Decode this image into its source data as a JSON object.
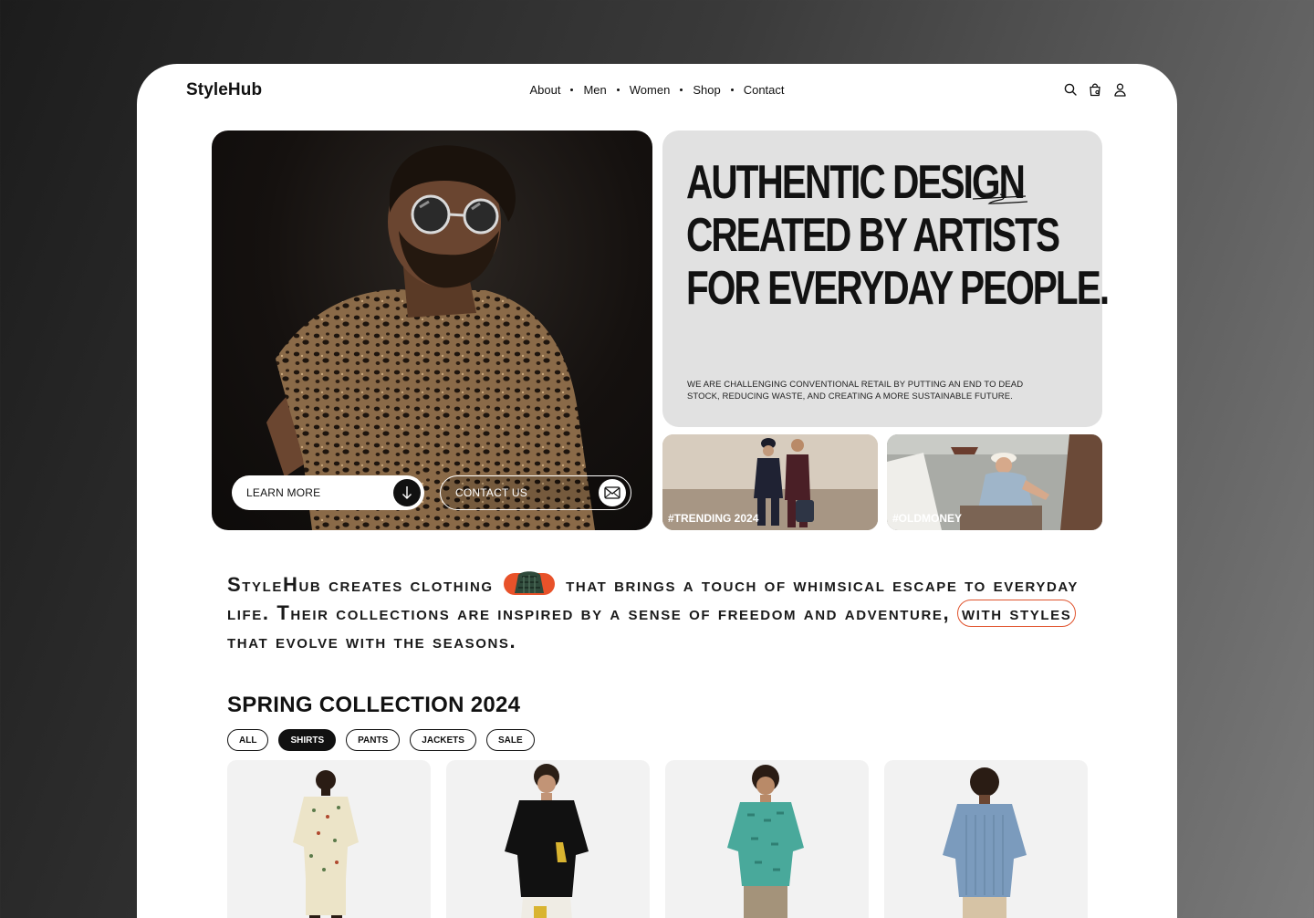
{
  "header": {
    "logo": "StyleHub",
    "nav": [
      "About",
      "Men",
      "Women",
      "Shop",
      "Contact"
    ],
    "icons": [
      "search-icon",
      "shopping-bag-icon",
      "user-icon"
    ]
  },
  "hero": {
    "learn_more": "LEARN MORE",
    "contact_us": "CONTACT US",
    "headline": [
      "AUTHENTIC DESIGN",
      "CREATED BY ARTISTS",
      "FOR EVERYDAY PEOPLE."
    ],
    "subtext": "WE ARE CHALLENGING CONVENTIONAL RETAIL BY PUTTING AN END TO DEAD STOCK, REDUCING WASTE, AND CREATING A MORE SUSTAINABLE FUTURE.",
    "tags": [
      "#TRENDING 2024",
      "#OLDMONEY"
    ]
  },
  "intro": {
    "part1": "StyleHub creates clothing",
    "part2": "that brings a touch of whimsical escape to everyday life. Their collections are inspired by a sense of freedom and adventure,",
    "highlight": "with styles",
    "part3": "that evolve with the seasons."
  },
  "collection": {
    "title": "SPRING COLLECTION 2024",
    "filters": [
      {
        "label": "ALL",
        "active": false
      },
      {
        "label": "SHIRTS",
        "active": true
      },
      {
        "label": "PANTS",
        "active": false
      },
      {
        "label": "JACKETS",
        "active": false
      },
      {
        "label": "SALE",
        "active": false
      }
    ]
  },
  "colors": {
    "accent": "#e0522c",
    "card_gray": "#e1e1e1",
    "dark": "#111111"
  }
}
